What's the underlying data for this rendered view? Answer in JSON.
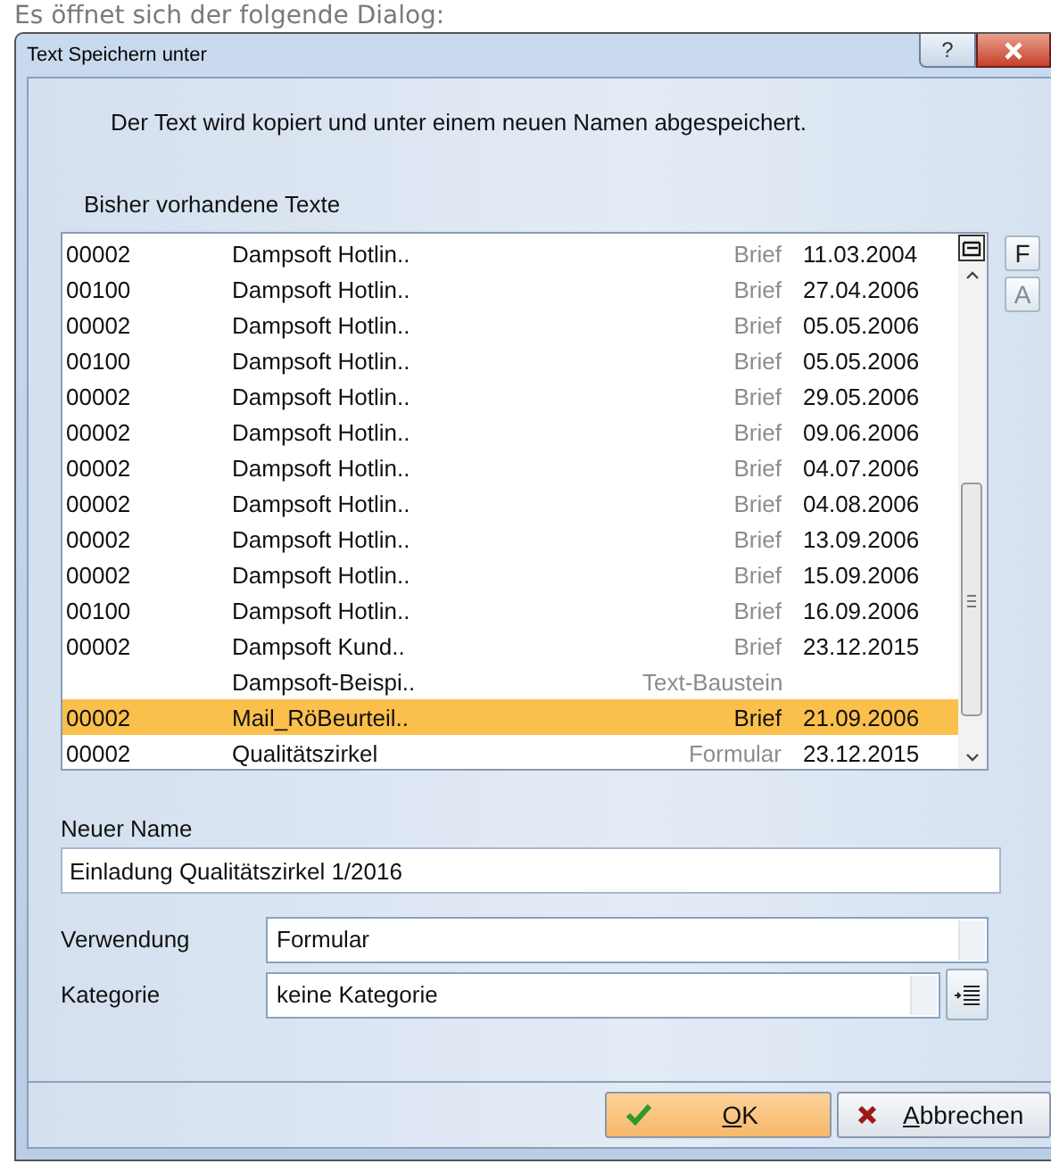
{
  "caption": "Es öffnet sich der folgende Dialog:",
  "window": {
    "title": "Text Speichern unter",
    "help": "?"
  },
  "message": "Der Text wird kopiert und unter einem neuen Namen abgespeichert.",
  "list": {
    "label": "Bisher vorhandene Texte",
    "side_buttons": [
      {
        "label": "F",
        "disabled": false
      },
      {
        "label": "A",
        "disabled": true
      }
    ],
    "rows": [
      {
        "number": "00002",
        "name": "Dampsoft Hotlin..",
        "type": "Brief",
        "date": "11.03.2004",
        "selected": false
      },
      {
        "number": "00100",
        "name": "Dampsoft Hotlin..",
        "type": "Brief",
        "date": "27.04.2006",
        "selected": false
      },
      {
        "number": "00002",
        "name": "Dampsoft Hotlin..",
        "type": "Brief",
        "date": "05.05.2006",
        "selected": false
      },
      {
        "number": "00100",
        "name": "Dampsoft Hotlin..",
        "type": "Brief",
        "date": "05.05.2006",
        "selected": false
      },
      {
        "number": "00002",
        "name": "Dampsoft Hotlin..",
        "type": "Brief",
        "date": "29.05.2006",
        "selected": false
      },
      {
        "number": "00002",
        "name": "Dampsoft Hotlin..",
        "type": "Brief",
        "date": "09.06.2006",
        "selected": false
      },
      {
        "number": "00002",
        "name": "Dampsoft Hotlin..",
        "type": "Brief",
        "date": "04.07.2006",
        "selected": false
      },
      {
        "number": "00002",
        "name": "Dampsoft Hotlin..",
        "type": "Brief",
        "date": "04.08.2006",
        "selected": false
      },
      {
        "number": "00002",
        "name": "Dampsoft Hotlin..",
        "type": "Brief",
        "date": "13.09.2006",
        "selected": false
      },
      {
        "number": "00002",
        "name": "Dampsoft Hotlin..",
        "type": "Brief",
        "date": "15.09.2006",
        "selected": false
      },
      {
        "number": "00100",
        "name": "Dampsoft Hotlin..",
        "type": "Brief",
        "date": "16.09.2006",
        "selected": false
      },
      {
        "number": "00002",
        "name": "Dampsoft Kund..",
        "type": "Brief",
        "date": "23.12.2015",
        "selected": false
      },
      {
        "name": "Dampsoft-Beispi..",
        "type": "Text-Baustein",
        "selected": false
      },
      {
        "number": "00002",
        "name": "Mail_RöBeurteil..",
        "type": "Brief",
        "date": "21.09.2006",
        "selected": true
      },
      {
        "number": "00002",
        "name": "Qualitätszirkel",
        "type": "Formular",
        "date": "23.12.2015",
        "selected": false
      }
    ]
  },
  "new_name": {
    "label": "Neuer Name",
    "value": "Einladung Qualitätszirkel 1/2016"
  },
  "usage": {
    "label": "Verwendung",
    "value": "Formular"
  },
  "category": {
    "label": "Kategorie",
    "value": "keine Kategorie"
  },
  "buttons": [
    {
      "kind": "ok",
      "label": "OK",
      "mnemonic_underlined": true
    },
    {
      "kind": "cancel",
      "label": "Abbrechen",
      "mnemonic_underlined": true
    }
  ]
}
